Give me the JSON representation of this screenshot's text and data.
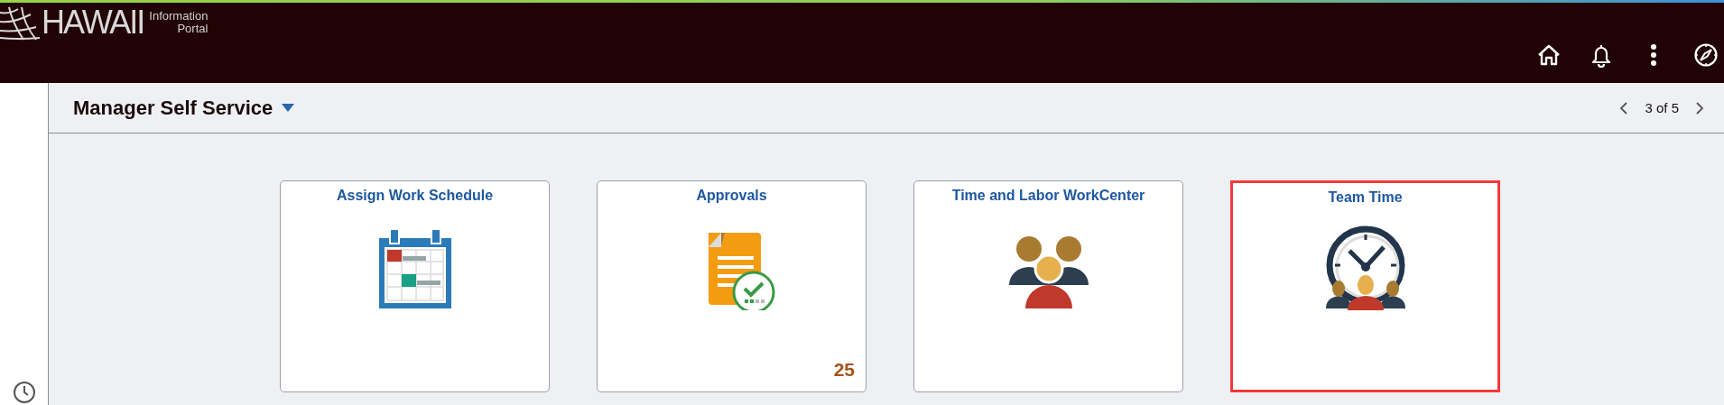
{
  "header": {
    "logo": {
      "wordmark": "HAWAII",
      "tagline": [
        "Information",
        "Portal"
      ]
    }
  },
  "page_bar": {
    "title": "Manager Self Service",
    "pager": "3 of 5"
  },
  "tiles": [
    {
      "title": "Assign Work Schedule",
      "kind": "calendar",
      "selected": false
    },
    {
      "title": "Approvals",
      "kind": "approvals",
      "badge": "25",
      "selected": false
    },
    {
      "title": "Time and Labor WorkCenter",
      "kind": "people",
      "selected": false
    },
    {
      "title": "Team Time",
      "kind": "team-clock",
      "selected": true
    }
  ]
}
